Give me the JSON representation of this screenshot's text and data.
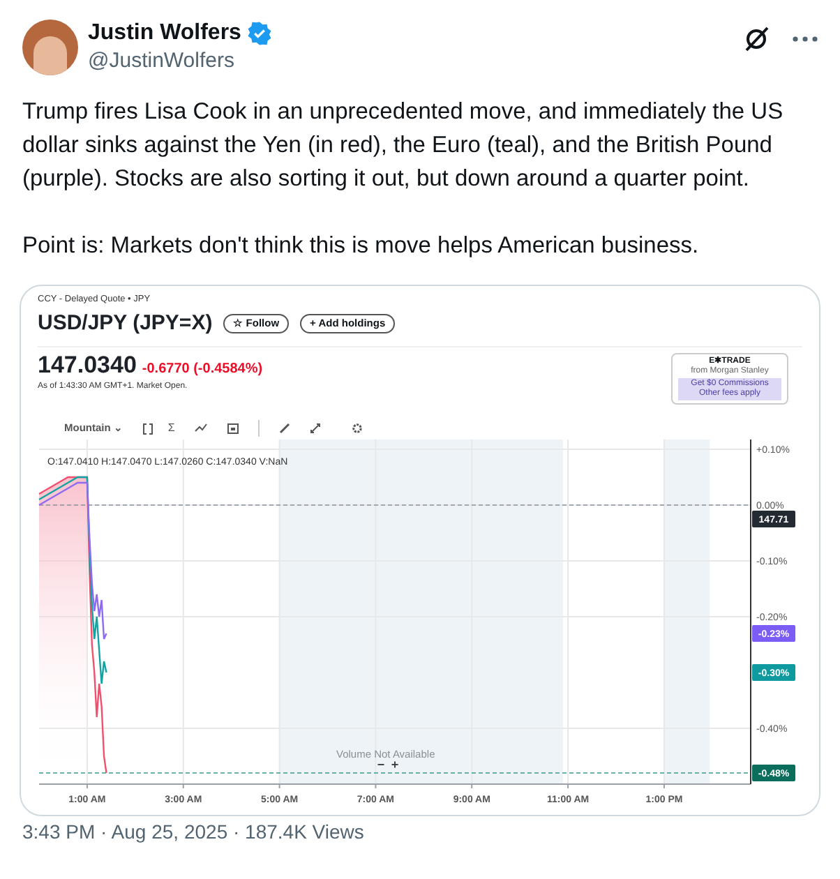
{
  "author": {
    "name": "Justin Wolfers",
    "handle": "@JustinWolfers",
    "verified": true
  },
  "tweet_text": [
    "Trump fires Lisa Cook in an unprecedented move, and immediately the US dollar sinks against the Yen (in red), the Euro (teal), and the British Pound (purple). Stocks are also sorting it out, but down around a quarter point.",
    "Point is: Markets don't think this is move helps American business."
  ],
  "quote": {
    "source": "CCY - Delayed Quote • JPY",
    "symbol": "USD/JPY (JPY=X)",
    "follow_button": "☆ Follow",
    "holdings_button": "+ Add holdings",
    "price": "147.0340",
    "change": "-0.6770 (-0.4584%)",
    "as_of": "As of 1:43:30 AM GMT+1. Market Open."
  },
  "ad": {
    "brand": "E✱TRADE",
    "tagline": "from Morgan Stanley",
    "offer": "Get $0 Commissions",
    "fine_print": "Other fees apply"
  },
  "toolbar": {
    "chart_type": "Mountain ⌄",
    "sigma": "Σ"
  },
  "ohlc": "O:147.0410  H:147.0470  L:147.0260  C:147.0340  V:NaN",
  "volume_note": "Volume Not Available",
  "zoom_buttons": [
    "−",
    "+"
  ],
  "chart": {
    "chart_data": {
      "type": "line",
      "x": [
        0,
        0.2,
        0.4,
        0.6,
        0.8,
        1.0,
        1.05,
        1.1,
        1.15,
        1.2,
        1.25,
        1.3,
        1.35,
        1.4
      ],
      "series": [
        {
          "color": "#f0506e",
          "values": [
            0.02,
            0.03,
            0.04,
            0.05,
            0.05,
            0.05,
            -0.12,
            -0.25,
            -0.3,
            -0.38,
            -0.32,
            -0.36,
            -0.45,
            -0.48
          ]
        },
        {
          "color": "#14a3a3",
          "values": [
            0.01,
            0.02,
            0.03,
            0.04,
            0.05,
            0.05,
            -0.08,
            -0.18,
            -0.24,
            -0.2,
            -0.26,
            -0.32,
            -0.28,
            -0.3
          ]
        },
        {
          "color": "#8f6bf0",
          "values": [
            0.0,
            0.01,
            0.02,
            0.03,
            0.04,
            0.04,
            -0.06,
            -0.14,
            -0.19,
            -0.16,
            -0.2,
            -0.17,
            -0.24,
            -0.23
          ]
        }
      ],
      "xlim": [
        0,
        14.8
      ],
      "ylim": [
        -0.5,
        0.1
      ],
      "xticks": [
        {
          "value": 1,
          "label": "1:00 AM"
        },
        {
          "value": 3,
          "label": "3:00 AM"
        },
        {
          "value": 5,
          "label": "5:00 AM"
        },
        {
          "value": 7,
          "label": "7:00 AM"
        },
        {
          "value": 9,
          "label": "9:00 AM"
        },
        {
          "value": 11,
          "label": "11:00 AM"
        },
        {
          "value": 13,
          "label": "1:00 PM"
        }
      ],
      "yticks": [
        {
          "value": 0.1,
          "label": "+0.10%"
        },
        {
          "value": 0,
          "label": "0.00%"
        },
        {
          "value": -0.1,
          "label": "-0.10%"
        },
        {
          "value": -0.2,
          "label": "-0.20%"
        },
        {
          "value": -0.4,
          "label": "-0.40%"
        }
      ],
      "grid": true,
      "ref_lines": [
        {
          "axis": "y",
          "value": 0
        },
        {
          "axis": "y",
          "value": -0.48
        }
      ]
    }
  },
  "axis_badges": [
    {
      "text": "147.71",
      "color": "#232a31"
    },
    {
      "text": "-0.23%",
      "color": "#7b5cf5"
    },
    {
      "text": "-0.30%",
      "color": "#0f9aa0"
    },
    {
      "text": "-0.48%",
      "color": "#0b6e5c"
    }
  ],
  "footer": "3:43 PM · Aug 25, 2025 · 187.4K Views"
}
